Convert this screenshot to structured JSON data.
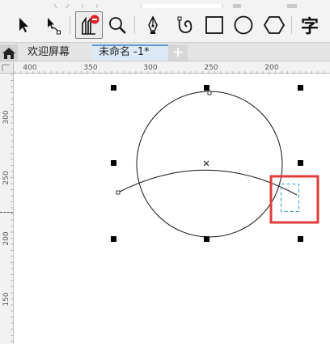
{
  "toolbar": {
    "tools": [
      {
        "name": "pick-tool",
        "icon": "arrow-cursor-icon"
      },
      {
        "name": "shape-tool",
        "icon": "node-arrow-icon"
      },
      {
        "name": "crop-tool",
        "icon": "crop-icon",
        "active": true
      },
      {
        "name": "zoom-tool",
        "icon": "magnifier-icon"
      },
      {
        "name": "pen-tool",
        "icon": "pen-nib-icon"
      },
      {
        "name": "artistic-media-tool",
        "icon": "spiral-curve-icon"
      },
      {
        "name": "rectangle-tool",
        "icon": "rectangle-icon"
      },
      {
        "name": "ellipse-tool",
        "icon": "ellipse-icon"
      },
      {
        "name": "polygon-tool",
        "icon": "hexagon-icon"
      },
      {
        "name": "text-tool",
        "icon": "text-char-icon"
      }
    ],
    "text_tool_glyph": "字"
  },
  "tabs": {
    "home_icon": "home-icon",
    "welcome": "欢迎屏幕",
    "document": "未命名 -1*",
    "add": "+"
  },
  "ruler": {
    "top_labels": [
      "400",
      "350",
      "300",
      "250",
      "200"
    ],
    "left_labels": [
      "300",
      "250",
      "200",
      "150"
    ]
  },
  "colors": {
    "highlight_box": "#e03c3c",
    "crop_box": "#2f8fd8",
    "active_badge": "#e0202a"
  }
}
